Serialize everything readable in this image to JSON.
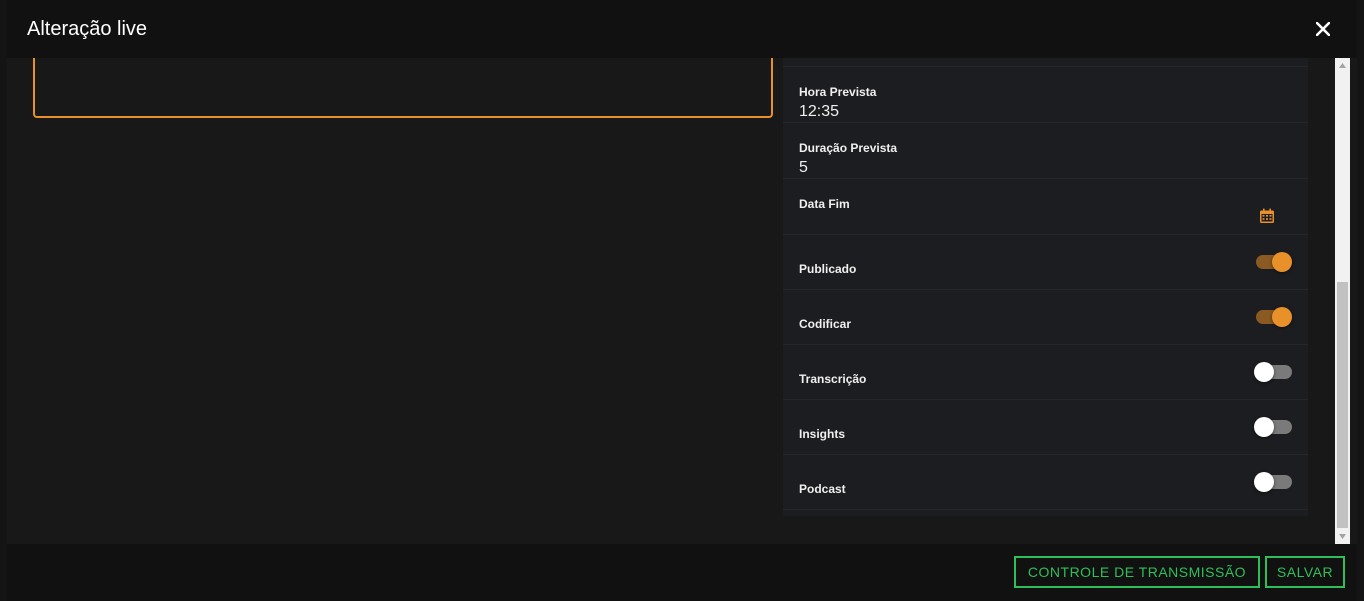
{
  "modal": {
    "title": "Alteração live",
    "close_icon": "close-icon"
  },
  "fields": [
    {
      "label": "Hora Prevista",
      "value": "12:35"
    },
    {
      "label": "Duração Prevista",
      "value": "5"
    },
    {
      "label": "Data Fim",
      "value": "",
      "icon": "calendar-icon"
    }
  ],
  "toggles": [
    {
      "label": "Publicado",
      "on": true
    },
    {
      "label": "Codificar",
      "on": true
    },
    {
      "label": "Transcrição",
      "on": false
    },
    {
      "label": "Insights",
      "on": false
    },
    {
      "label": "Podcast",
      "on": false
    }
  ],
  "footer": {
    "control_label": "CONTROLE DE TRANSMISSÃO",
    "save_label": "SALVAR"
  },
  "colors": {
    "accent": "#e8902a",
    "button": "#2fbf5a"
  }
}
